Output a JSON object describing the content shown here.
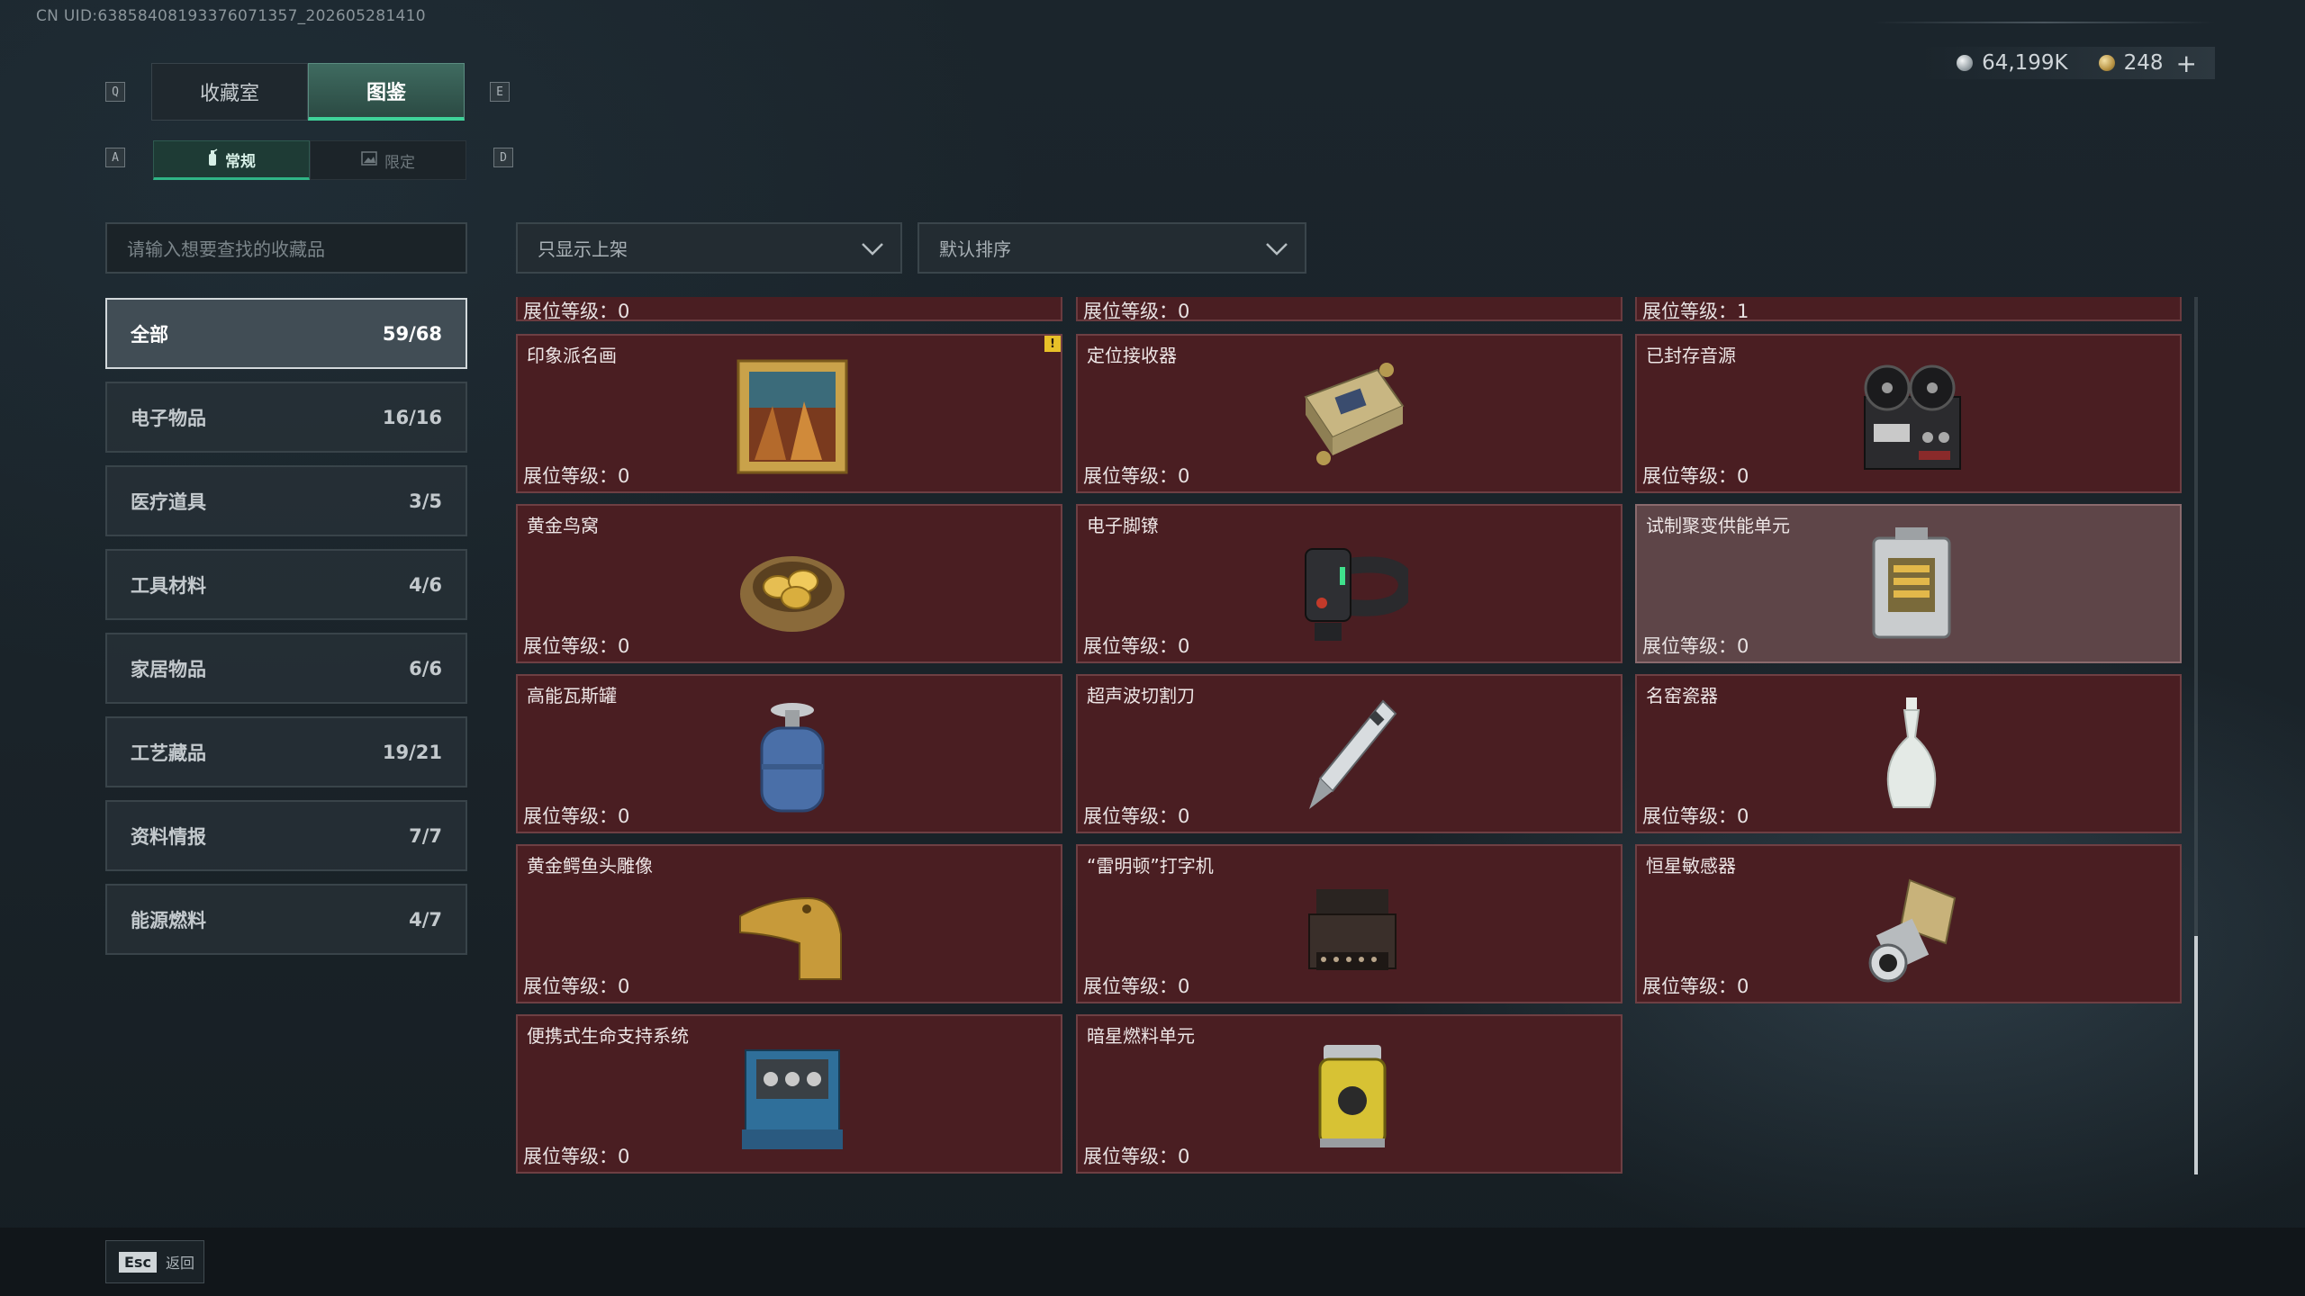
{
  "uid_text": "CN UID:63858408193376071357_202605281410",
  "currency": {
    "silver": "64,199K",
    "gold": "248",
    "plus": "+"
  },
  "keys": {
    "q": "Q",
    "e": "E",
    "a": "A",
    "d": "D"
  },
  "tabs": [
    {
      "label": "收藏室"
    },
    {
      "label": "图鉴"
    }
  ],
  "subtabs": [
    {
      "label": "常规",
      "icon": "fire-extinguisher-icon"
    },
    {
      "label": "限定",
      "icon": "image-icon"
    }
  ],
  "search": {
    "placeholder": "请输入想要查找的收藏品"
  },
  "filters": {
    "shelf": "只显示上架",
    "sort": "默认排序"
  },
  "categories": [
    {
      "label": "全部",
      "count": "59/68"
    },
    {
      "label": "电子物品",
      "count": "16/16"
    },
    {
      "label": "医疗道具",
      "count": "3/5"
    },
    {
      "label": "工具材料",
      "count": "4/6"
    },
    {
      "label": "家居物品",
      "count": "6/6"
    },
    {
      "label": "工艺藏品",
      "count": "19/21"
    },
    {
      "label": "资料情报",
      "count": "7/7"
    },
    {
      "label": "能源燃料",
      "count": "4/7"
    }
  ],
  "level_prefix": "展位等级：",
  "top_strip": [
    {
      "level": "0"
    },
    {
      "level": "0"
    },
    {
      "level": "1"
    }
  ],
  "items": [
    {
      "name": "印象派名画",
      "level": "0",
      "icon": "framed-painting-icon",
      "warning": "!"
    },
    {
      "name": "定位接收器",
      "level": "0",
      "icon": "gps-receiver-icon"
    },
    {
      "name": "已封存音源",
      "level": "0",
      "icon": "reel-tape-recorder-icon"
    },
    {
      "name": "黄金鸟窝",
      "level": "0",
      "icon": "golden-nest-icon"
    },
    {
      "name": "电子脚镣",
      "level": "0",
      "icon": "ankle-monitor-icon"
    },
    {
      "name": "试制聚变供能单元",
      "level": "0",
      "icon": "fusion-core-icon"
    },
    {
      "name": "高能瓦斯罐",
      "level": "0",
      "icon": "gas-canister-icon"
    },
    {
      "name": "超声波切割刀",
      "level": "0",
      "icon": "ultrasonic-cutter-icon"
    },
    {
      "name": "名窑瓷器",
      "level": "0",
      "icon": "porcelain-vase-icon"
    },
    {
      "name": "黄金鳄鱼头雕像",
      "level": "0",
      "icon": "golden-crocodile-statue-icon"
    },
    {
      "name": "“雷明顿”打字机",
      "level": "0",
      "icon": "typewriter-icon"
    },
    {
      "name": "恒星敏感器",
      "level": "0",
      "icon": "star-sensor-icon"
    },
    {
      "name": "便携式生命支持系统",
      "level": "0",
      "icon": "life-support-icon"
    },
    {
      "name": "暗星燃料单元",
      "level": "0",
      "icon": "fuel-cell-icon"
    }
  ],
  "bottom": {
    "esc_key": "Esc",
    "back_label": "返回"
  }
}
